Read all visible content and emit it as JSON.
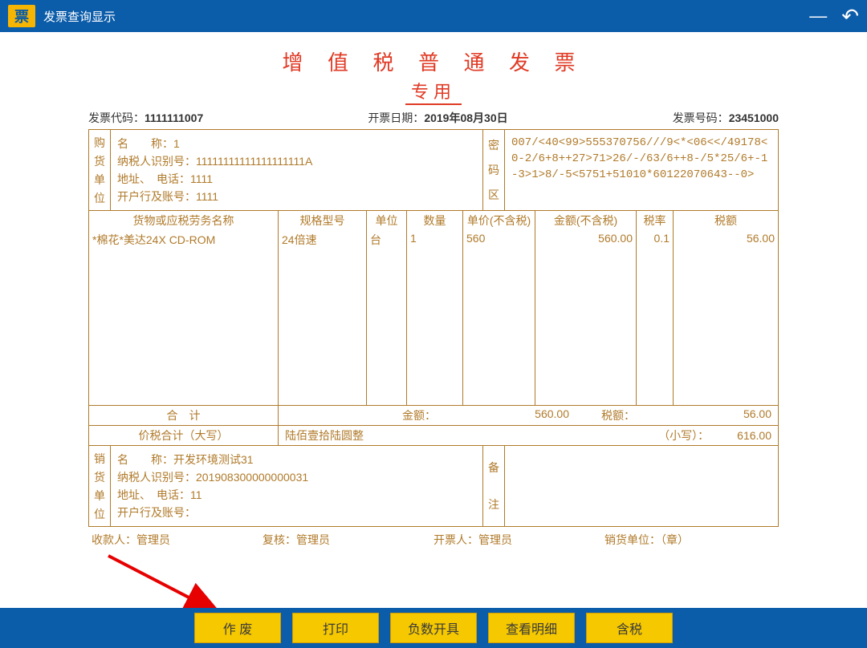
{
  "window": {
    "logo_text": "票",
    "title": "发票查询显示",
    "minimize": "—",
    "back_icon": "↶"
  },
  "invoice": {
    "title": "增 值 税 普 通 发 票",
    "subtitle": "专用",
    "header": {
      "code_label": "发票代码：",
      "code": "1111111007",
      "date_label": "开票日期：",
      "date": "2019年08月30日",
      "number_label": "发票号码：",
      "number": "23451000"
    },
    "buyer": {
      "section_chars": [
        "购",
        "货",
        "单",
        "位"
      ],
      "name_label": "名　　称：",
      "name": "1",
      "taxid_label": "纳税人识别号：",
      "taxid": "11111111111111111111A",
      "addr_label": "地址、　电话：",
      "addr": "1111",
      "bank_label": "开户行及账号：",
      "bank": "1111"
    },
    "cipher": {
      "section_chars": [
        "密",
        "码",
        "区"
      ],
      "line1": "007/<40<99>555370756///9<*<06<</49178<0-2/6+8++27>71>26/-/63/6++8-/5*25/6+-1-3>1>8/-5<5751+51010*60122070643--0>"
    },
    "columns": {
      "name": "货物或应税劳务名称",
      "spec": "规格型号",
      "unit": "单位",
      "qty": "数量",
      "price": "单价(不含税)",
      "amount": "金额(不含税)",
      "rate": "税率",
      "tax": "税额"
    },
    "item": {
      "name": "*棉花*美达24X CD-ROM",
      "spec": "24倍速",
      "unit": "台",
      "qty": "1",
      "price": "560",
      "amount": "560.00",
      "rate": "0.1",
      "tax": "56.00"
    },
    "total": {
      "label": "合　计",
      "amount_label": "金额：",
      "amount": "560.00",
      "tax_label": "税额：",
      "tax": "56.00"
    },
    "capital": {
      "label": "价税合计（大写）",
      "text": "陆佰壹拾陆圆整",
      "small_label": "（小写）：",
      "small": "616.00"
    },
    "seller": {
      "section_chars": [
        "销",
        "货",
        "单",
        "位"
      ],
      "name_label": "名　　称：",
      "name": "开发环境测试31",
      "taxid_label": "纳税人识别号：",
      "taxid": "201908300000000031",
      "addr_label": "地址、　电话：",
      "addr": "11",
      "bank_label": "开户行及账号：",
      "bank": ""
    },
    "remark": {
      "section_chars": [
        "备",
        "注"
      ]
    },
    "signatures": {
      "payee_label": "收款人：",
      "payee": "管理员",
      "reviewer_label": "复核：",
      "reviewer": "管理员",
      "drawer_label": "开票人：",
      "drawer": "管理员",
      "seller_unit_label": "销货单位：（章）"
    }
  },
  "buttons": {
    "void": "作 废",
    "print": "打印",
    "negative": "负数开具",
    "detail": "查看明细",
    "tax_inc": "含税"
  }
}
